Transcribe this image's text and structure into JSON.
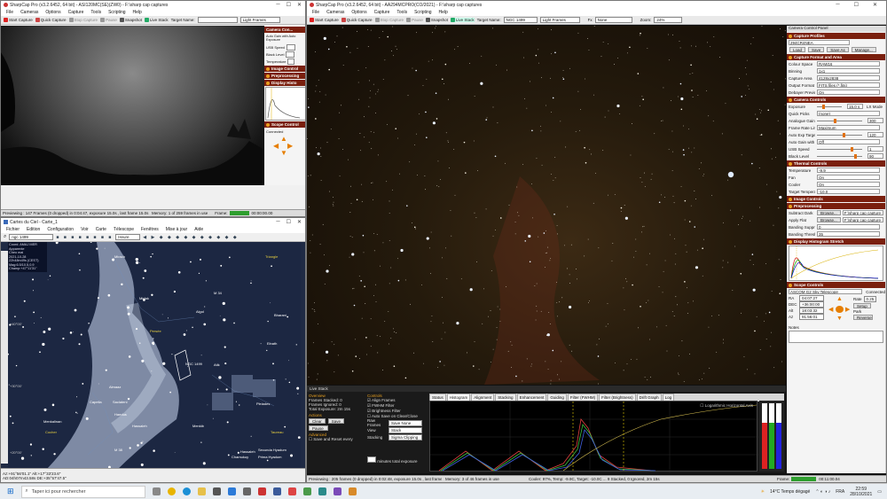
{
  "left_top": {
    "title": "SharpCap Pro (v3.2.6452, 64 bit) - ASI120MC(SE)(ZW0) - F:\\sharp cap captures",
    "menu": [
      "File",
      "Cameras",
      "Options",
      "Capture",
      "Tools",
      "Scripting",
      "Help"
    ],
    "toolbar": [
      "Start Capture",
      "Quick Capture",
      "Stop Capture",
      "Pause",
      "Snapshot",
      "Live Stack",
      "Target Name:"
    ],
    "frame_type": "Light Frames",
    "side": {
      "title": "Camera Con...",
      "auto_label": "Auto Gain with Auto Exposure",
      "usb": "USB Speed",
      "black": "Black Level",
      "temp": "Temperature",
      "sections": [
        "Image Control",
        "Preprocessing",
        "Display Histo",
        "Scope Control"
      ],
      "connected": "Connected"
    },
    "status": "Previewing : 147 Frames (0 dropped) in 0:04:47, exposure 15.0s , last frame 15.0s",
    "memory": "Memory: 1 of 259 frames in use",
    "frames_label": "Frame:",
    "clock": "00:00:00.00"
  },
  "cdc": {
    "title": "Cartes du Ciel - Carte_1",
    "menu": [
      "Fichier",
      "Edition",
      "Configuration",
      "Voir",
      "Carte",
      "Télescope",
      "Fenêtres",
      "Mise à jour",
      "Aide"
    ],
    "search": "ngc 1499",
    "time_unit": "Heure",
    "info": [
      "Coord. AMAJ MER",
      "Apparente",
      "Cheo mai",
      "2021-10-28",
      "22h48m49s (CEST)",
      "Mag:6.5/10.5,0.9",
      "Champ:+47°11'31\""
    ],
    "labels": [
      {
        "t": "Triangle",
        "c": "#e8d040"
      },
      {
        "t": "Persée",
        "c": "#e8d040"
      },
      {
        "t": "Cocher",
        "c": "#e8d040"
      },
      {
        "t": "Taureau",
        "c": "#e8d040"
      },
      {
        "t": "NGC 1499",
        "c": "#fff"
      },
      {
        "t": "Mirach",
        "c": "#fff"
      },
      {
        "t": "Mirfak",
        "c": "#fff"
      },
      {
        "t": "Algol",
        "c": "#fff"
      },
      {
        "t": "Menkalinan",
        "c": "#fff"
      },
      {
        "t": "Capella",
        "c": "#fff"
      },
      {
        "t": "Almaaz",
        "c": "#fff"
      },
      {
        "t": "Saclateni",
        "c": "#fff"
      },
      {
        "t": "Haedus",
        "c": "#fff"
      },
      {
        "t": "M 34",
        "c": "#fff"
      },
      {
        "t": "M 38",
        "c": "#fff"
      },
      {
        "t": "Elnath",
        "c": "#fff"
      },
      {
        "t": "Atik",
        "c": "#fff"
      },
      {
        "t": "Menkib",
        "c": "#fff"
      },
      {
        "t": "Hassaleh",
        "c": "#fff"
      },
      {
        "t": "Pleiades",
        "c": "#fff"
      },
      {
        "t": "Bharani",
        "c": "#fff"
      },
      {
        "t": "+40°00'",
        "c": "#ccc"
      },
      {
        "t": "+30°00'",
        "c": "#ccc"
      },
      {
        "t": "+20°00'",
        "c": "#ccc"
      },
      {
        "t": "Chamukuy",
        "c": "#fff"
      },
      {
        "t": "Secunda Hyadum",
        "c": "#fff"
      },
      {
        "t": "Prima Hyadum",
        "c": "#fff"
      },
      {
        "t": "Hassaleh",
        "c": "#fff"
      }
    ],
    "status1": "Az:+91°56'01.1\" Alt:+17°33'23.6\"",
    "status2": "AD:04h07m43.58s DE:+35°57'47.5\""
  },
  "main": {
    "title": "SharpCap Pro (v3.2.6452, 64 bit) - AA294MCPRO(CO/2021) - F:\\sharp cap captures",
    "menu": [
      "File",
      "Cameras",
      "Options",
      "Capture",
      "Tools",
      "Scripting",
      "Help"
    ],
    "toolbar": [
      "Start Capture",
      "Quick Capture",
      "Stop Capture",
      "Pause",
      "Snapshot",
      "Live Stack",
      "Target Name:"
    ],
    "target": "NGC 1499",
    "frame_type": "Light Frames",
    "fx": "Fx",
    "fx_val": "None",
    "zoom_label": "Zoom:",
    "zoom": "24%",
    "panel": {
      "header": "Camera Control Panel",
      "sections": {
        "profiles": "Capture Profiles",
        "profile_name": "294CR4NEA",
        "profile_btns": [
          "Load",
          "Save",
          "Save As",
          "Manage..."
        ],
        "format": "Capture Format and Area",
        "format_rows": [
          [
            "Colour Space",
            "RAW16"
          ],
          [
            "Binning",
            "1x1"
          ],
          [
            "Capture Area",
            "4128x2838"
          ],
          [
            "Output Format",
            "FITS files (*.fits)"
          ],
          [
            "Debayer Preview",
            "On"
          ]
        ],
        "camera": "Camera Controls",
        "camera_rows": [
          [
            "Exposure",
            "15.0 s"
          ],
          [
            "Quick Picks",
            "(none)"
          ],
          [
            "Analogue Gain",
            "300"
          ],
          [
            "Frame Rate Limit",
            "Maximum"
          ],
          [
            "Auto Exp Target",
            "120"
          ],
          [
            "Auto Gain with Auto Exposure",
            "Off"
          ],
          [
            "USB Speed",
            "1"
          ],
          [
            "Black Level",
            "90"
          ]
        ],
        "lx": "LX Mode",
        "auto": "Auto",
        "thermal": "Thermal Controls",
        "thermal_rows": [
          [
            "Temperature",
            "-9.9"
          ],
          [
            "Fan",
            "On"
          ],
          [
            "Cooler",
            "On"
          ],
          [
            "Target Temperature",
            "-10.0"
          ]
        ],
        "image": "Image Controls",
        "pre": "Preprocessing",
        "pre_rows": [
          [
            "Subtract Dark",
            "Browse...",
            "F:\\sharp cap capture"
          ],
          [
            "Apply Flat",
            "Browse...",
            "F:\\sharp cap capture"
          ],
          [
            "Banding Suppression",
            "0"
          ],
          [
            "Banding Threshold",
            "35"
          ]
        ],
        "hist": "Display Histogram Stretch",
        "scope": "Scope Controls",
        "scope_name": "ASCOM G2 Sky Telescope",
        "connected": "Connected",
        "scope_rows": [
          [
            "RA",
            "04:07:27"
          ],
          [
            "DEC",
            "+36:00:00"
          ],
          [
            "Alt",
            "18:03:32"
          ],
          [
            "Az",
            "91:56:01"
          ]
        ],
        "rate": "Rate",
        "rate_val": "0.25",
        "setup": "Setup",
        "park": "Park",
        "reverse": "Reverse",
        "notes": "Notes"
      }
    },
    "livestack": {
      "title": "Live Stack",
      "overview": "Overview",
      "frames_stacked": "Frames Stacked: 0",
      "frames_ignored": "Frames Ignored: 0",
      "total_exposure": "Total Exposure: 2m 15s",
      "actions": "Actions",
      "clear": "Clear",
      "save": "Save",
      "pause": "Pause",
      "advanced": "Advanced",
      "save_reset": "Save and Reset every",
      "minutes": "minutes total exposure",
      "controls": "Controls",
      "checks": [
        "Align Frames",
        "FWHM Filter",
        "Brightness Filter",
        "Auto Save on Clear/Close"
      ],
      "raw_frames": "Raw Frames",
      "raw_val": "Save None",
      "view": "View",
      "view_val": "Stack",
      "stacking": "Stacking",
      "stacking_val": "Sigma Clipping",
      "tabs": [
        "Status",
        "Histogram",
        "Alignment",
        "Stacking",
        "Enhancement",
        "Guiding",
        "Filter (FWHM)",
        "Filter (Brightness)",
        "Drift Graph",
        "Log"
      ],
      "logarithmic": "Logarithmic Horizontal Axis"
    },
    "status": "Previewing : 205 frames (0 dropped) in 0:02:48, exposure 15.0s , last frame 15.0s",
    "memory": "Memory: 3 of 46 frames in use",
    "temp": "Cooler: 97%, Temp: -9.9C, Target: -10.0C ... 9 Stacked, 0 Ignored, 2m 15s",
    "frame_label": "Frame:",
    "clock": "00:11:00.04"
  },
  "taskbar": {
    "search": "Taper ici pour rechercher",
    "weather": "14°C Temps dégagé",
    "lang": "FRA",
    "time": "22:59",
    "date": "28/10/2021"
  }
}
